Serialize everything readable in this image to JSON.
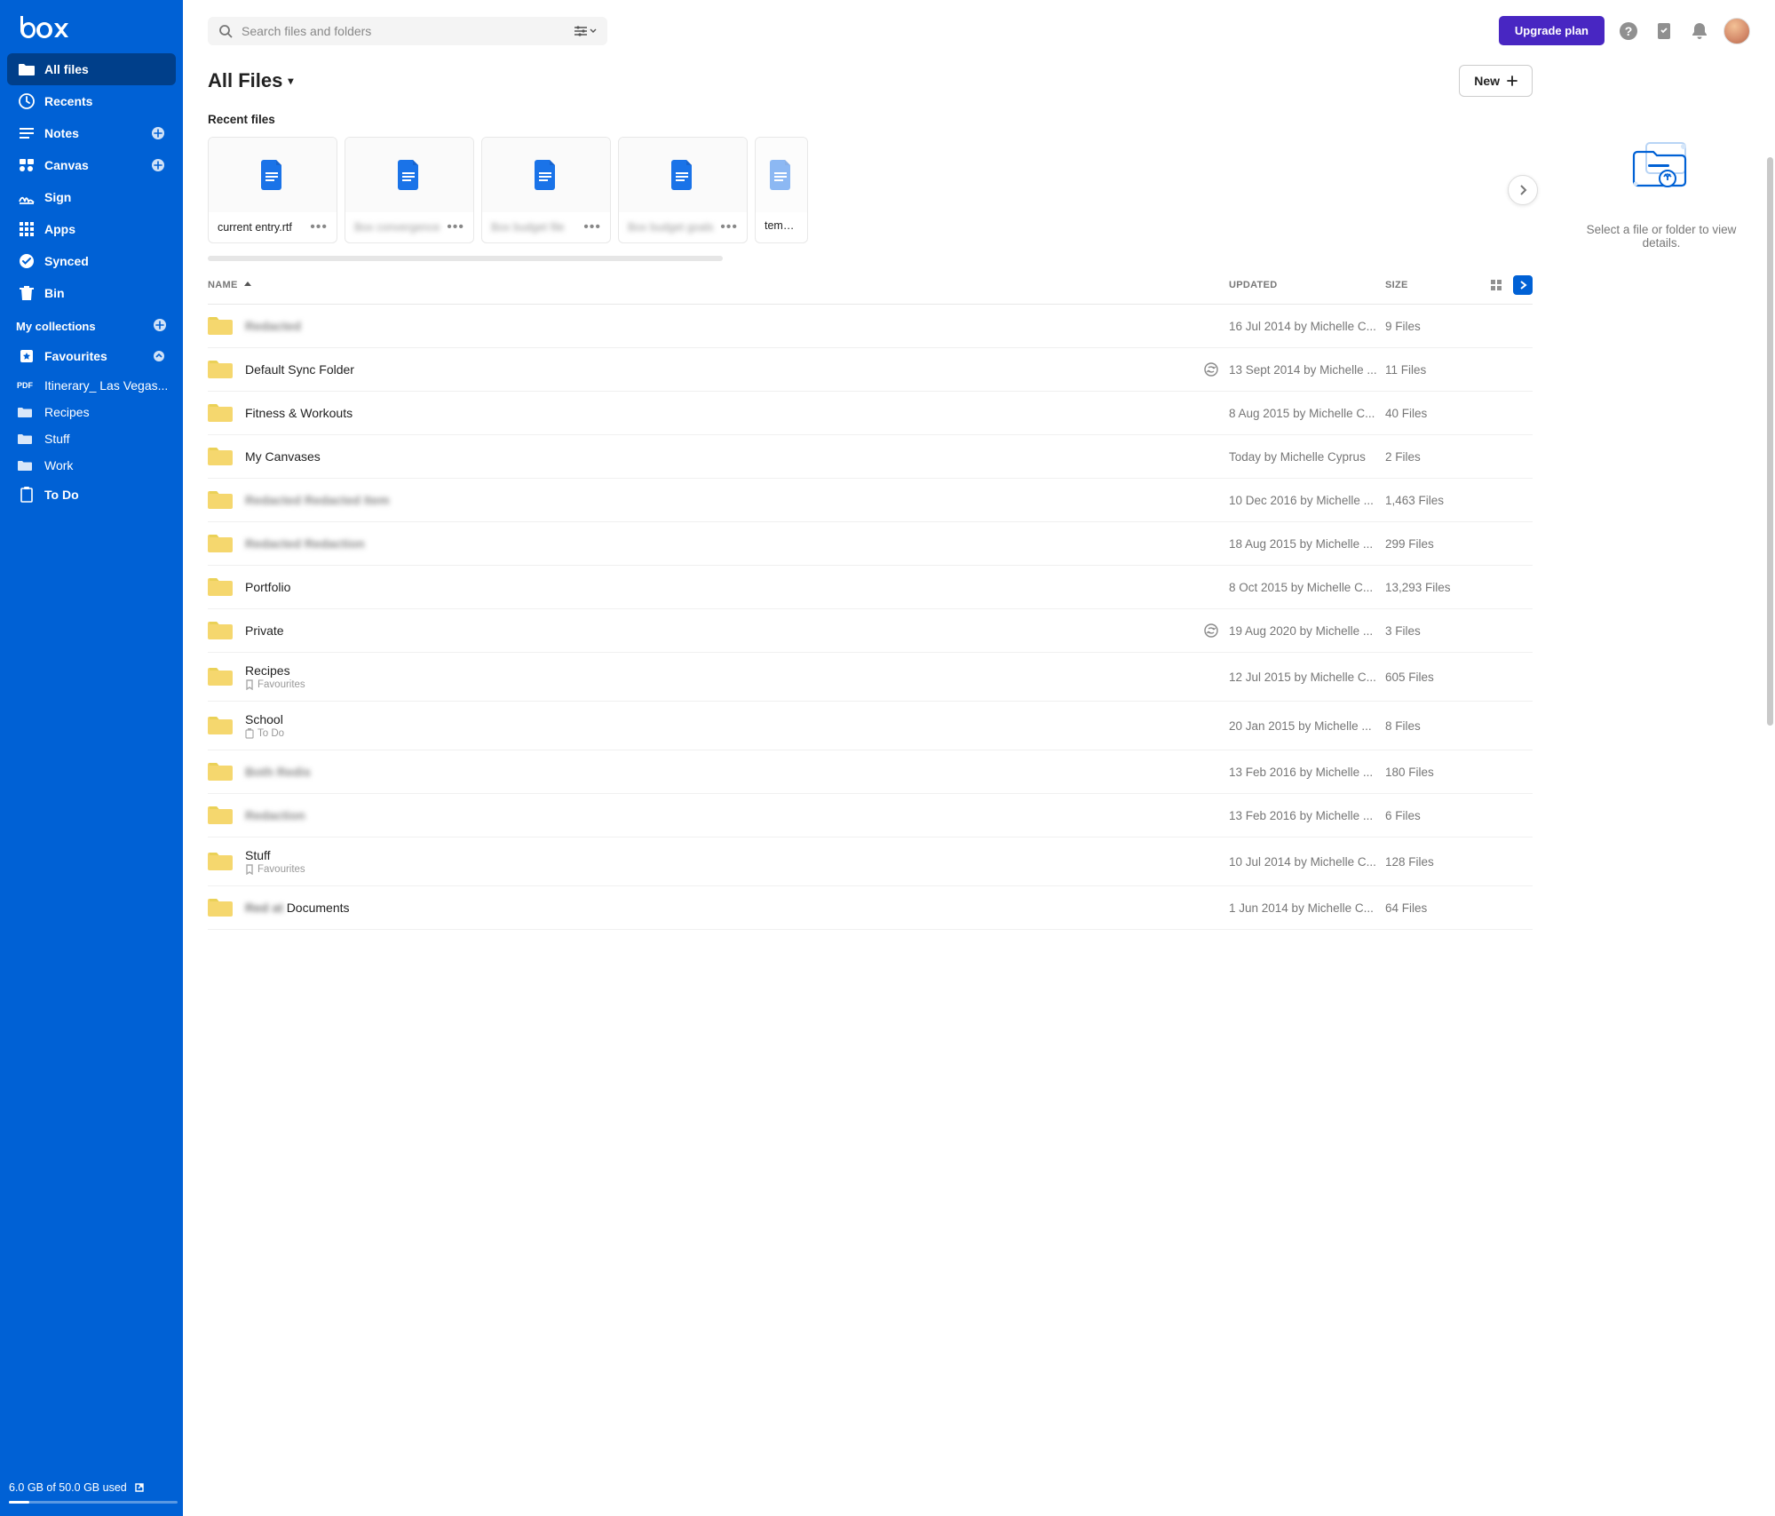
{
  "sidebar": {
    "logo_text": "box",
    "nav": [
      {
        "label": "All files",
        "icon": "folder"
      },
      {
        "label": "Recents",
        "icon": "clock"
      },
      {
        "label": "Notes",
        "icon": "notes",
        "plus": true
      },
      {
        "label": "Canvas",
        "icon": "canvas",
        "plus": true
      },
      {
        "label": "Sign",
        "icon": "sign"
      },
      {
        "label": "Apps",
        "icon": "apps"
      },
      {
        "label": "Synced",
        "icon": "check"
      },
      {
        "label": "Bin",
        "icon": "bin"
      }
    ],
    "collections_label": "My collections",
    "favourites_label": "Favourites",
    "fav_items": [
      {
        "label": "Itinerary_ Las Vegas...",
        "type": "pdf"
      },
      {
        "label": "Recipes",
        "type": "folder"
      },
      {
        "label": "Stuff",
        "type": "folder"
      },
      {
        "label": "Work",
        "type": "folder"
      }
    ],
    "todo_label": "To Do",
    "storage_text": "6.0 GB of 50.0 GB used"
  },
  "header": {
    "search_placeholder": "Search files and folders",
    "upgrade_label": "Upgrade plan",
    "new_label": "New"
  },
  "page": {
    "title": "All Files",
    "recent_label": "Recent files"
  },
  "recent": [
    {
      "name": "current entry.rtf",
      "blur": false
    },
    {
      "name": "Box convergence",
      "blur": true
    },
    {
      "name": "Box budget file",
      "blur": true
    },
    {
      "name": "Box budget goals",
      "blur": true
    },
    {
      "name": "template",
      "blur": false,
      "nodots": true
    }
  ],
  "table": {
    "name_header": "NAME",
    "updated_header": "UPDATED",
    "size_header": "SIZE"
  },
  "files": [
    {
      "name": "Redacted",
      "blur": true,
      "updated": "16 Jul 2014 by Michelle C...",
      "size": "9 Files"
    },
    {
      "name": "Default Sync Folder",
      "updated": "13 Sept 2014 by Michelle ...",
      "size": "11 Files",
      "sync": true
    },
    {
      "name": "Fitness & Workouts",
      "updated": "8 Aug 2015 by Michelle C...",
      "size": "40 Files"
    },
    {
      "name": "My Canvases",
      "updated": "Today by Michelle Cyprus",
      "size": "2 Files"
    },
    {
      "name": "Redacted Redacted Item",
      "blur": true,
      "updated": "10 Dec 2016 by Michelle ...",
      "size": "1,463 Files"
    },
    {
      "name": "Redacted Redaction",
      "blur": true,
      "updated": "18 Aug 2015 by Michelle ...",
      "size": "299 Files"
    },
    {
      "name": "Portfolio",
      "updated": "8 Oct 2015 by Michelle C...",
      "size": "13,293 Files"
    },
    {
      "name": "Private",
      "updated": "19 Aug 2020 by Michelle ...",
      "size": "3 Files",
      "sync": true
    },
    {
      "name": "Recipes",
      "updated": "12 Jul 2015 by Michelle C...",
      "size": "605 Files",
      "tag": "Favourites",
      "tagicon": "bookmark"
    },
    {
      "name": "School",
      "updated": "20 Jan 2015 by Michelle ...",
      "size": "8 Files",
      "tag": "To Do",
      "tagicon": "todo"
    },
    {
      "name": "Both Redis",
      "blur": true,
      "updated": "13 Feb 2016 by Michelle ...",
      "size": "180 Files"
    },
    {
      "name": "Redaction",
      "blur": true,
      "updated": "13 Feb 2016 by Michelle ...",
      "size": "6 Files"
    },
    {
      "name": "Stuff",
      "updated": "10 Jul 2014 by Michelle C...",
      "size": "128 Files",
      "tag": "Favourites",
      "tagicon": "bookmark"
    },
    {
      "name": "Red at Documents",
      "blur": "partial",
      "blurtext": "Red at ",
      "cleartext": "Documents",
      "updated": "1 Jun 2014 by Michelle C...",
      "size": "64 Files"
    }
  ],
  "details": {
    "message": "Select a file or folder to view details."
  }
}
